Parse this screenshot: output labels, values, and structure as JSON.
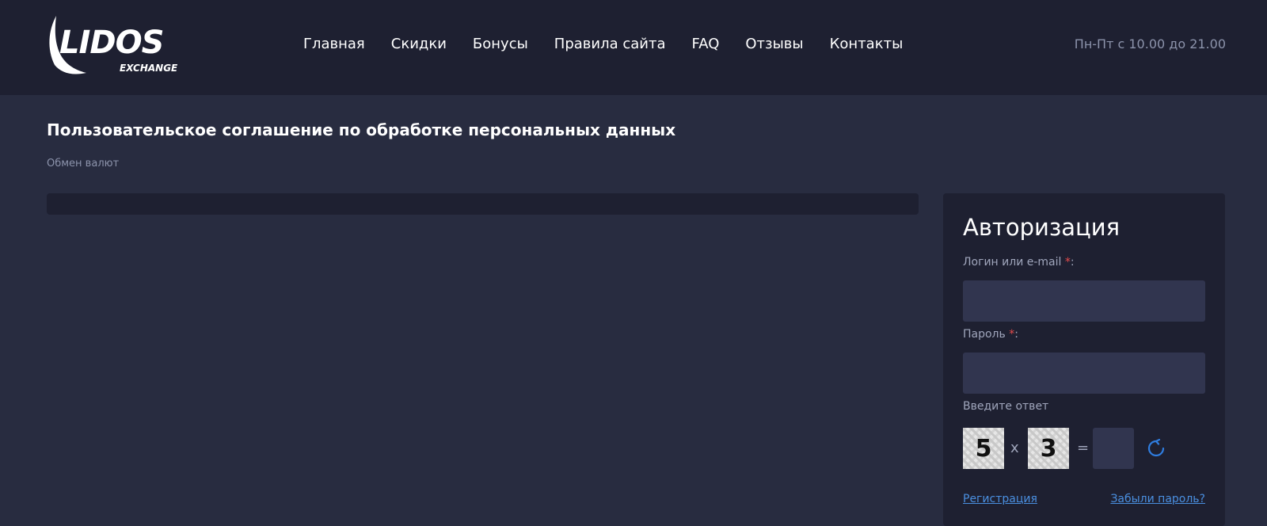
{
  "header": {
    "logo_main": "LIDOS",
    "logo_sub": "EXCHANGE",
    "nav": [
      {
        "label": "Главная"
      },
      {
        "label": "Скидки"
      },
      {
        "label": "Бонусы"
      },
      {
        "label": "Правила сайта"
      },
      {
        "label": "FAQ"
      },
      {
        "label": "Отзывы"
      },
      {
        "label": "Контакты"
      }
    ],
    "hours": "Пн-Пт с 10.00 до 21.00"
  },
  "main": {
    "title": "Пользовательское соглашение по обработке персональных данных",
    "breadcrumb": "Обмен валют"
  },
  "auth": {
    "title": "Авторизация",
    "login_label": "Логин или e-mail",
    "password_label": "Пароль",
    "required_mark": "*",
    "colon": ":",
    "login_value": "",
    "password_value": "",
    "captcha_label": "Введите ответ",
    "captcha_a": "5",
    "captcha_op": "x",
    "captcha_b": "3",
    "captcha_eq": "=",
    "captcha_answer": "",
    "register_link": "Регистрация",
    "forgot_link": "Забыли пароль?"
  },
  "colors": {
    "header_bg": "#1e2031",
    "page_bg": "#282c40",
    "input_bg": "#31354f",
    "link": "#4a8fe0",
    "required": "#e74c4c"
  },
  "icons": {
    "refresh": "refresh-icon",
    "logo_wing": "wing-icon"
  }
}
